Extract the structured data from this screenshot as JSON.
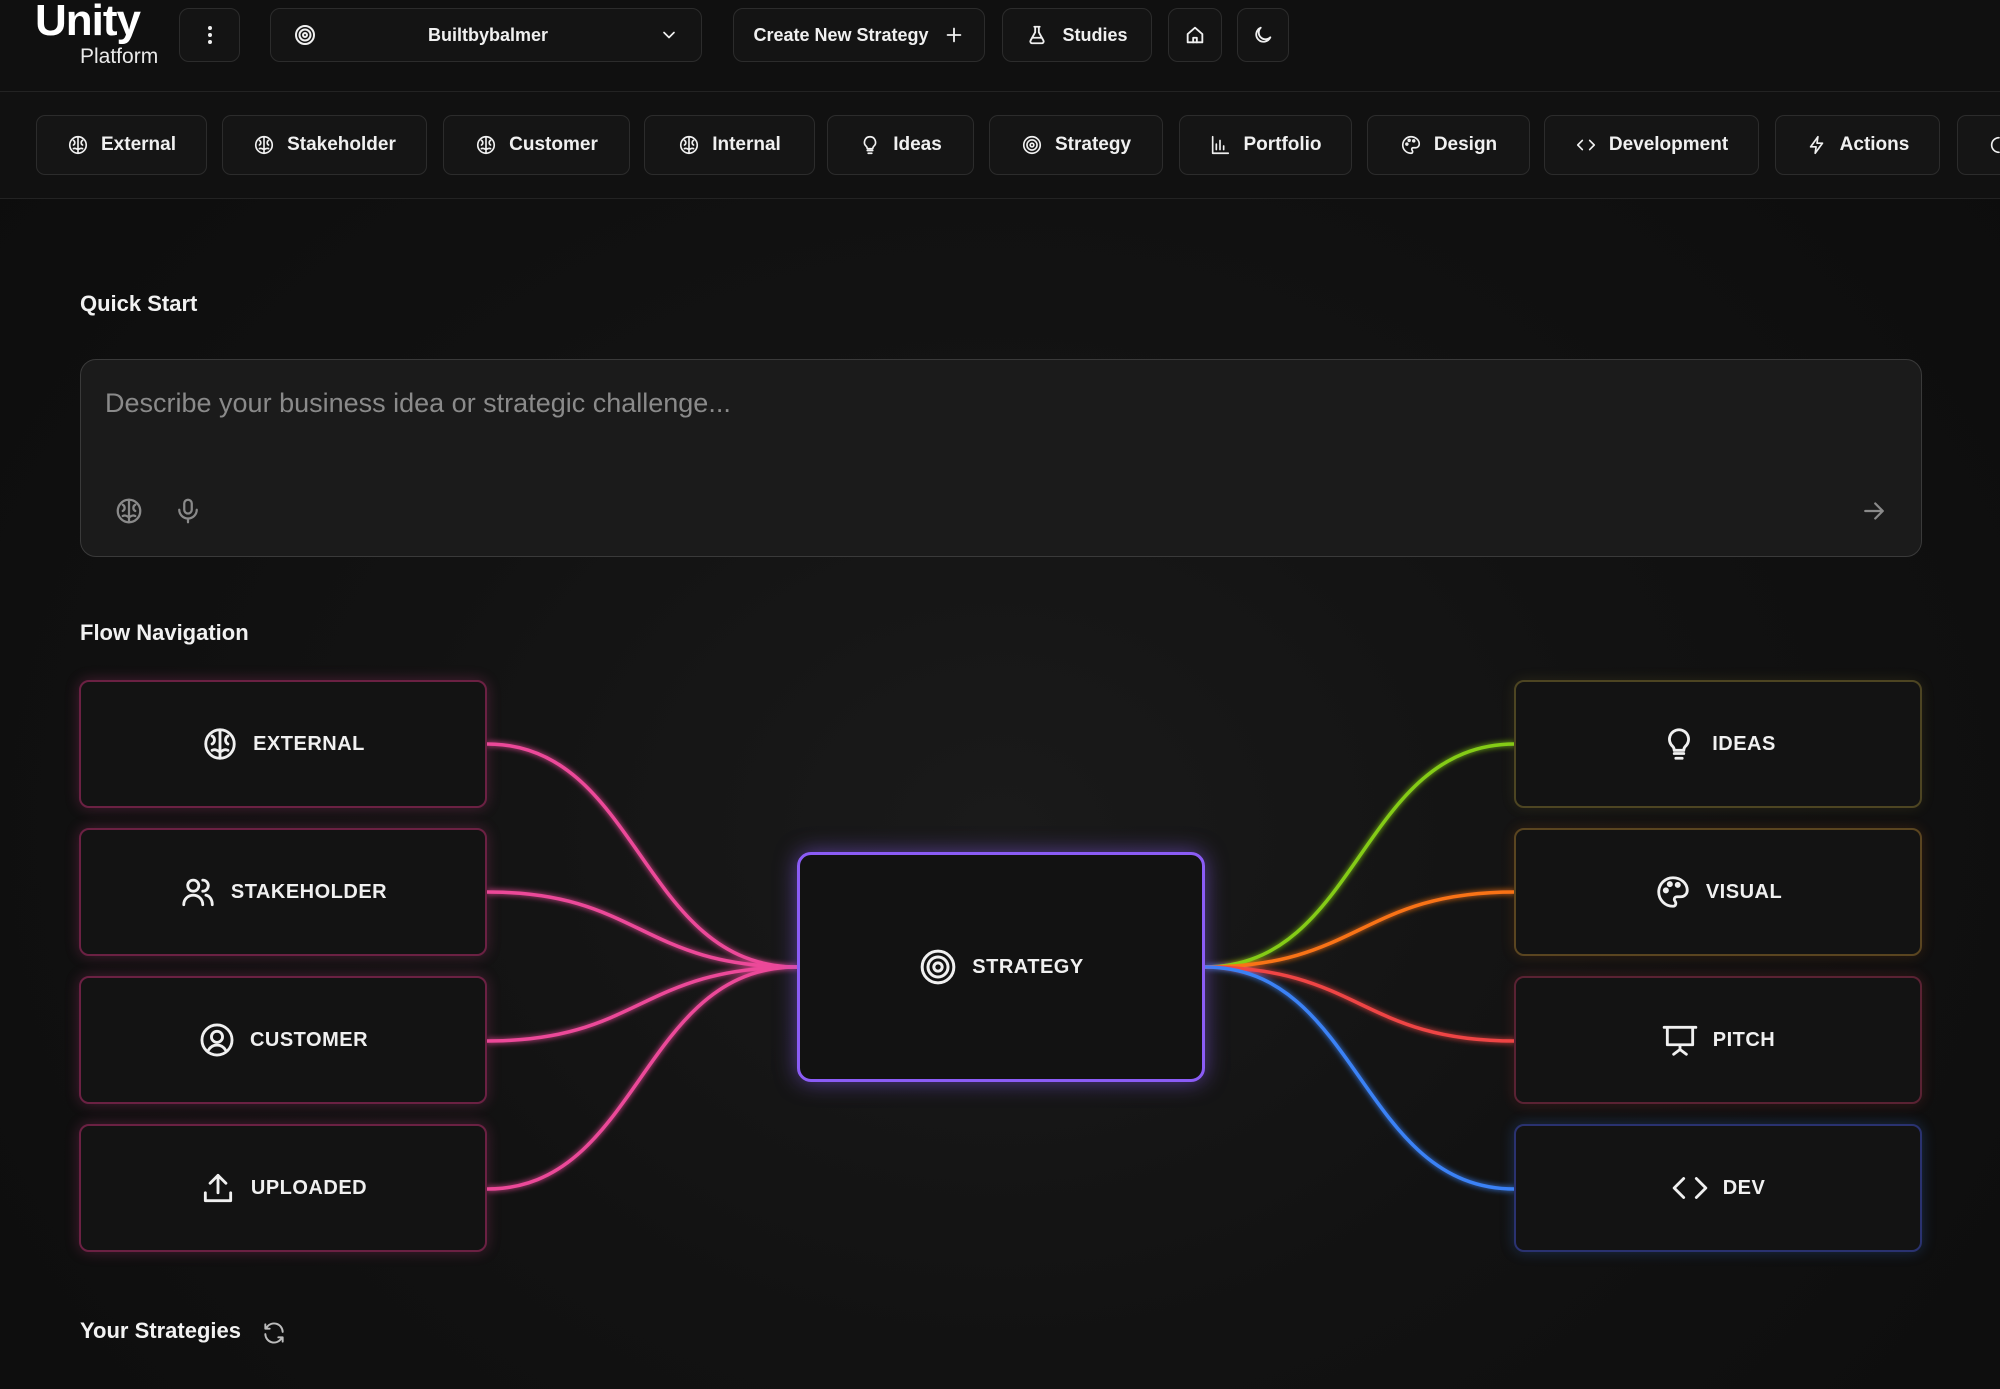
{
  "app": {
    "title": "Unity",
    "subtitle": "Platform"
  },
  "toolbar": {
    "project_name": "Builtbybalmer",
    "create_label": "Create New Strategy",
    "studies_label": "Studies"
  },
  "tabs": [
    {
      "label": "External",
      "icon": "brain-icon"
    },
    {
      "label": "Stakeholder",
      "icon": "brain-icon"
    },
    {
      "label": "Customer",
      "icon": "brain-icon"
    },
    {
      "label": "Internal",
      "icon": "brain-icon"
    },
    {
      "label": "Ideas",
      "icon": "lightbulb-icon"
    },
    {
      "label": "Strategy",
      "icon": "target-icon"
    },
    {
      "label": "Portfolio",
      "icon": "bar-chart-icon"
    },
    {
      "label": "Design",
      "icon": "palette-icon"
    },
    {
      "label": "Development",
      "icon": "code-icon"
    },
    {
      "label": "Actions",
      "icon": "lightning-icon"
    }
  ],
  "quick_start": {
    "heading": "Quick Start",
    "placeholder": "Describe your business idea or strategic challenge..."
  },
  "flow": {
    "heading": "Flow Navigation",
    "center": {
      "label": "STRATEGY",
      "icon": "target-icon",
      "color": "#8b5cf6"
    },
    "inputs": [
      {
        "label": "EXTERNAL",
        "icon": "brain-icon",
        "color": "#ec4899"
      },
      {
        "label": "STAKEHOLDER",
        "icon": "users-icon",
        "color": "#ec4899"
      },
      {
        "label": "CUSTOMER",
        "icon": "user-circle-icon",
        "color": "#ec4899"
      },
      {
        "label": "UPLOADED",
        "icon": "upload-icon",
        "color": "#ec4899"
      }
    ],
    "outputs": [
      {
        "label": "IDEAS",
        "icon": "lightbulb-icon",
        "color": "#84cc16"
      },
      {
        "label": "VISUAL",
        "icon": "palette-icon",
        "color": "#f97316"
      },
      {
        "label": "PITCH",
        "icon": "presentation-icon",
        "color": "#ef4444"
      },
      {
        "label": "DEV",
        "icon": "code-icon",
        "color": "#3b82f6"
      }
    ]
  },
  "strategies": {
    "heading": "Your Strategies"
  }
}
